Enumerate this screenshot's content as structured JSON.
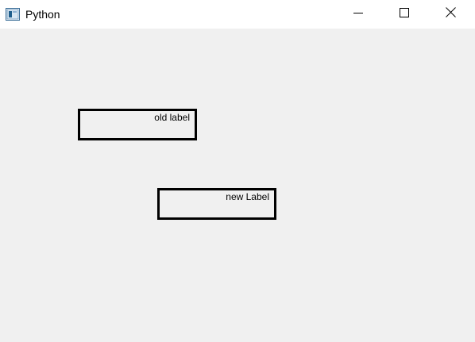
{
  "window": {
    "title": "Python",
    "icon": "python-window-icon",
    "controls": [
      "minimize-icon",
      "maximize-icon",
      "close-icon"
    ]
  },
  "labels": {
    "old": "old label",
    "new": "new Label"
  },
  "colors": {
    "titlebar_bg": "#ffffff",
    "client_bg": "#f0f0f0",
    "border": "#000000",
    "icon_blue": "#1f5e8c"
  }
}
